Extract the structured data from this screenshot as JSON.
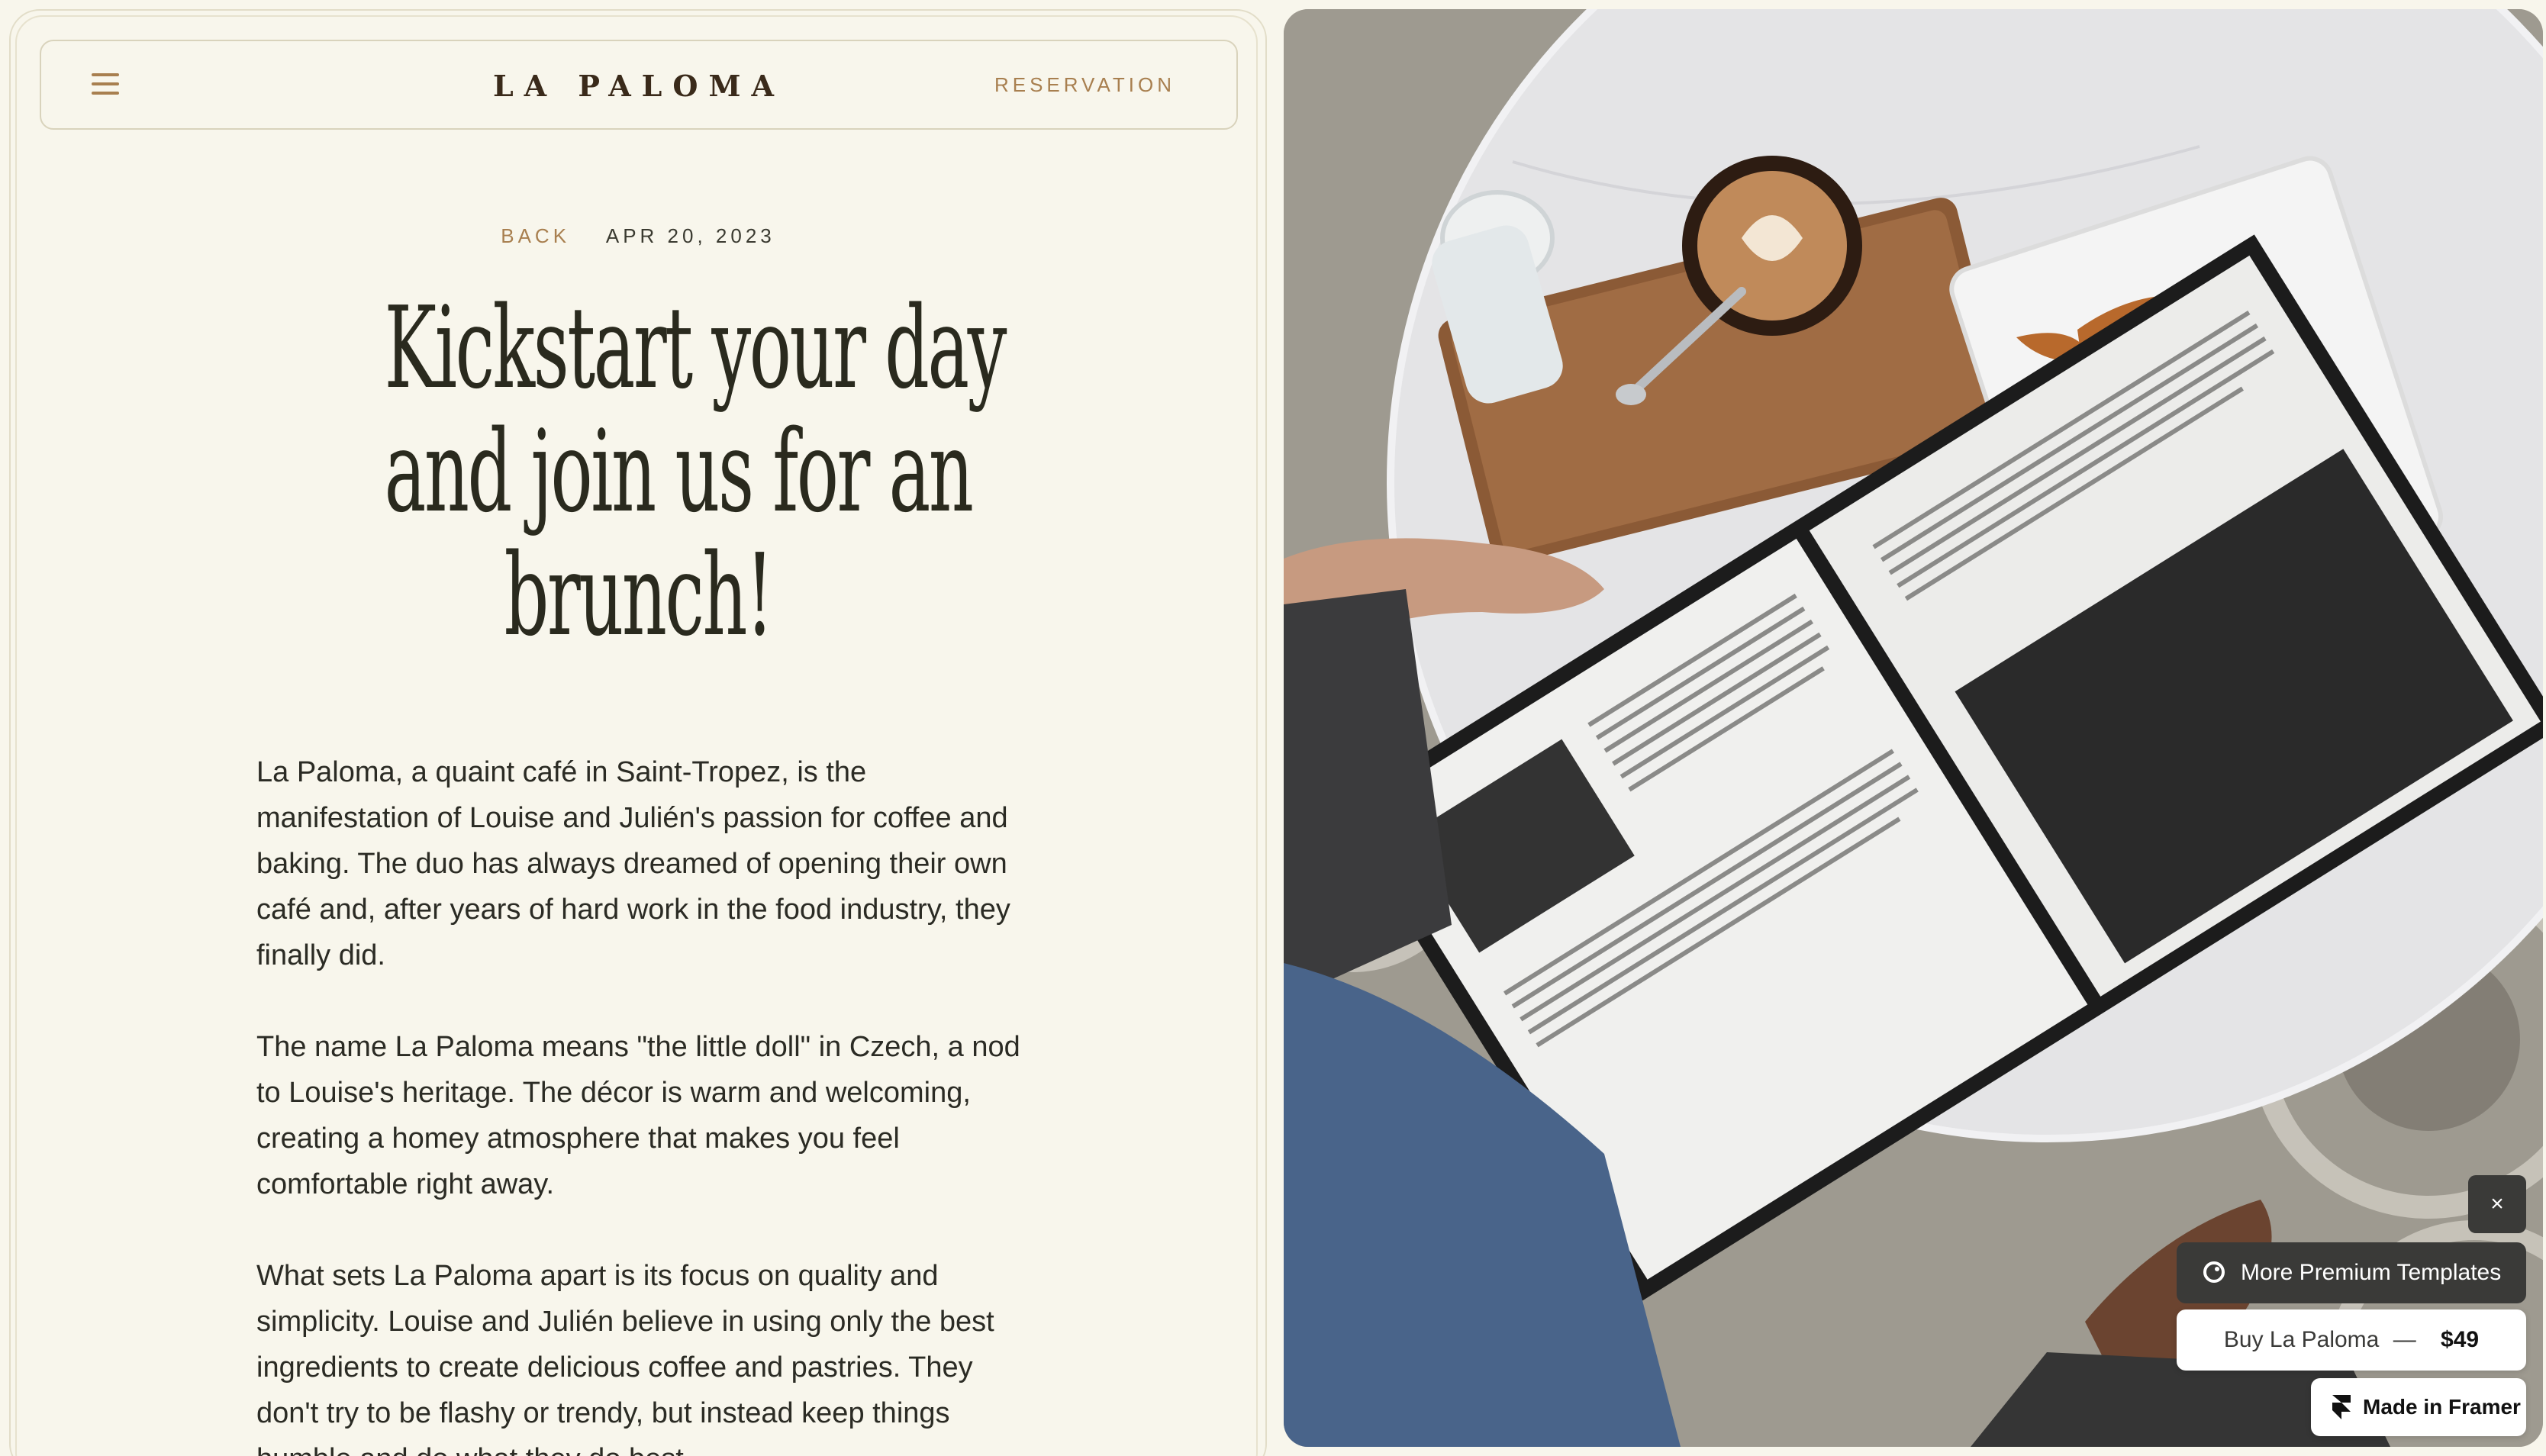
{
  "nav": {
    "menu_icon": "hamburger-menu-icon",
    "logo_text": "LA PALOMA",
    "reservation_label": "RESERVATION"
  },
  "article": {
    "back_label": "BACK",
    "date": "APR 20, 2023",
    "headline": [
      "Kickstart your day",
      "and join us for an",
      "brunch!"
    ],
    "paragraphs": [
      "La Paloma, a quaint café in Saint-Tropez, is the manifestation of Louise and Julién's passion for coffee and baking. The duo has always dreamed of opening their own café and, after years of hard work in the food industry, they finally did.",
      "The name La Paloma means \"the little doll\" in Czech, a nod to Louise's heritage. The décor is warm and welcoming, creating a homey atmosphere that makes you feel comfortable right away.",
      "What sets La Paloma apart is its focus on quality and simplicity. Louise and Julién believe in using only the best ingredients to create delicious coffee and pastries. They don't try to be flashy or trendy, but instead keep things humble and do what they do best."
    ]
  },
  "framer": {
    "close_label": "×",
    "premium_label": "More Premium Templates",
    "buy_label": "Buy La Paloma",
    "buy_dash": "—",
    "buy_price": "$49",
    "made_label": "Made in Framer"
  },
  "colors": {
    "background": "#f8f6ec",
    "accent": "#a87f4f",
    "text": "#2b2b24",
    "badge_dark": "#3a3a38"
  }
}
